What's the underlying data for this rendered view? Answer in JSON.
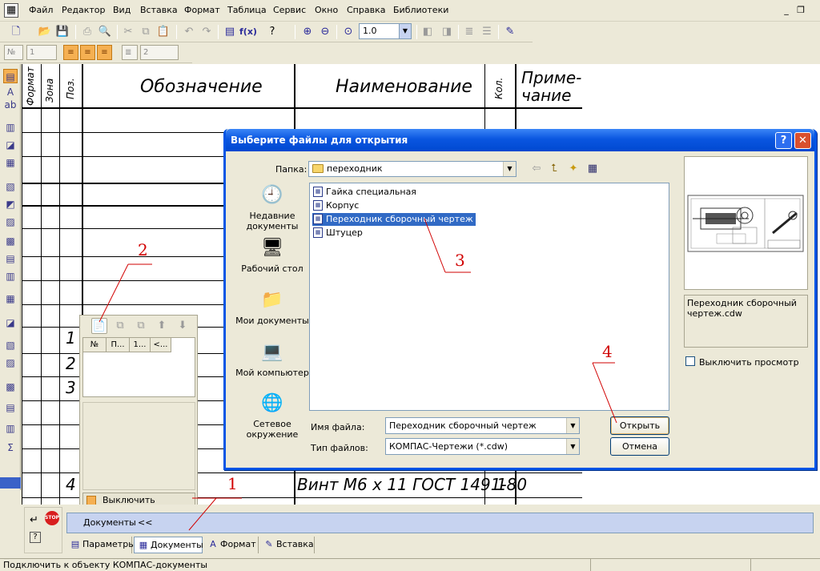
{
  "menubar": {
    "items": [
      "Файл",
      "Редактор",
      "Вид",
      "Вставка",
      "Формат",
      "Таблица",
      "Сервис",
      "Окно",
      "Справка",
      "Библиотеки"
    ],
    "underline": [
      "Ф",
      "Р",
      "В",
      "В",
      "Ф",
      "Т",
      "С",
      "О",
      "С",
      "Б"
    ]
  },
  "window_controls": {
    "minimize": "_",
    "restore": "❐"
  },
  "toolbar": {
    "zoom_value": "1.0",
    "small_field_value": "1",
    "small_field2_value": "2",
    "formula_label": "f(x)"
  },
  "table_header": {
    "format": "Формат",
    "zone": "Зона",
    "pos": "Поз.",
    "designation": "Обозначение",
    "name": "Наименование",
    "qty": "Кол.",
    "note_line1": "Приме-",
    "note_line2": "чание"
  },
  "rows": {
    "pos1": "1",
    "pos2": "2",
    "pos3": "3",
    "pos4": "4",
    "name4": "Винт М6 х 11 ГОСТ 1491-80",
    "qty4": "1"
  },
  "spec_panel": {
    "columns": [
      "№",
      "П...",
      "1...",
      "<..."
    ],
    "disable_preview": "Выключить просмотр"
  },
  "doc_strip": {
    "label": "Документы",
    "collapse": "<<"
  },
  "tabs": [
    {
      "label": "Параметры",
      "icon": "params-icon"
    },
    {
      "label": "Документы",
      "icon": "documents-icon"
    },
    {
      "label": "Формат",
      "icon": "format-icon"
    },
    {
      "label": "Вставка",
      "icon": "insert-icon"
    }
  ],
  "status": {
    "text": "Подключить к объекту КОМПАС-документы"
  },
  "dialog": {
    "title": "Выберите файлы для открытия",
    "help": "?",
    "close": "✕",
    "folder_label": "Папка:",
    "folder_value": "переходник",
    "places": [
      {
        "label": "Недавние документы",
        "icon": "recent-documents-icon",
        "glyph": "🕘"
      },
      {
        "label": "Рабочий стол",
        "icon": "desktop-icon",
        "glyph": "🖥"
      },
      {
        "label": "Мои документы",
        "icon": "my-documents-icon",
        "glyph": "📁"
      },
      {
        "label": "Мой компьютер",
        "icon": "my-computer-icon",
        "glyph": "💻"
      },
      {
        "label": "Сетевое окружение",
        "icon": "network-icon",
        "glyph": "🌐"
      }
    ],
    "files": [
      {
        "name": "Гайка специальная",
        "selected": false
      },
      {
        "name": "Корпус",
        "selected": false
      },
      {
        "name": "Переходник сборочный чертеж",
        "selected": true
      },
      {
        "name": "Штуцер",
        "selected": false
      }
    ],
    "filename_label": "Имя файла:",
    "filename_value": "Переходник сборочный чертеж",
    "filetype_label": "Тип файлов:",
    "filetype_value": "КОМПАС-Чертежи (*.cdw)",
    "open_button": "Открыть",
    "cancel_button": "Отмена",
    "preview_name": "Переходник сборочный чертеж.cdw",
    "disable_preview": "Выключить просмотр"
  },
  "annotations": {
    "n1": "1",
    "n2": "2",
    "n3": "3",
    "n4": "4"
  },
  "colors": {
    "annotation": "#d10000",
    "title_bar": "#0a56e0",
    "selection": "#316ac5"
  }
}
